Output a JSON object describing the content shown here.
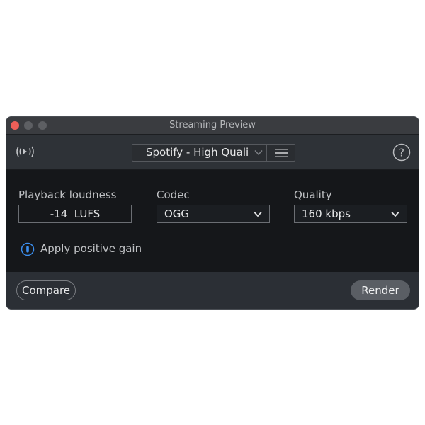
{
  "window": {
    "title": "Streaming Preview"
  },
  "toolbar": {
    "broadcast_icon": "broadcast-icon",
    "preset_value": "Spotify - High Quality",
    "menu_icon": "hamburger-menu-icon",
    "help_icon": "question-mark-icon"
  },
  "fields": {
    "loudness_label": "Playback loudness",
    "loudness_value": "-14  LUFS",
    "codec_label": "Codec",
    "codec_value": "OGG",
    "quality_label": "Quality",
    "quality_value": "160 kbps"
  },
  "gain": {
    "label": "Apply positive gain",
    "enabled": false
  },
  "footer": {
    "compare_label": "Compare",
    "render_label": "Render"
  },
  "colors": {
    "accent": "#3b8ff0",
    "close": "#ed5f58"
  }
}
